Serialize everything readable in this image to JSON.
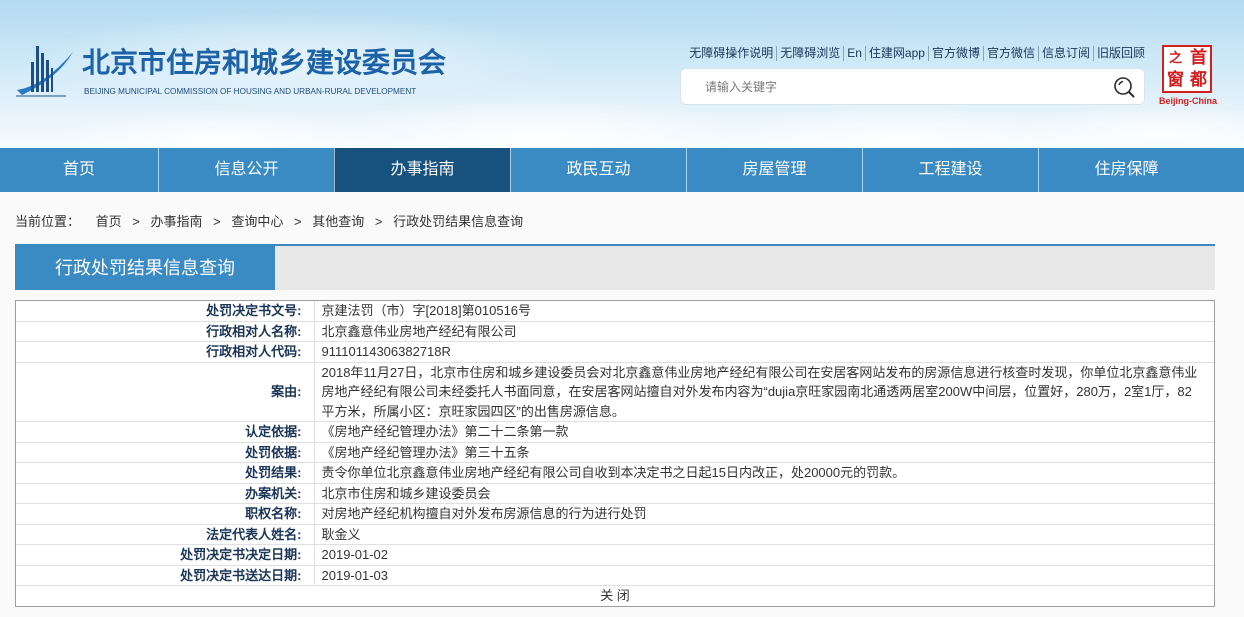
{
  "colors": {
    "primary": "#3a8ac3",
    "nav_active": "#17517e",
    "title_blue": "#1d62a7",
    "label_navy": "#1b3556",
    "portal_red": "#d0201f"
  },
  "header": {
    "title": "北京市住房和城乡建设委员会",
    "subtitle": "BEIJING MUNICIPAL COMMISSION OF HOUSING AND URBAN-RURAL DEVELOPMENT",
    "logo_icon": "commission-logo-icon",
    "top_links": [
      "无障碍操作说明",
      "无障碍浏览",
      "En",
      "住建网app",
      "官方微博",
      "官方微信",
      "信息订阅",
      "旧版回顾"
    ],
    "search": {
      "placeholder": "请输入关键字",
      "icon": "search-icon"
    },
    "portal_logo": {
      "char_1": "之",
      "char_2": "首",
      "char_3": "窗",
      "char_4": "都",
      "caption": "Beijing-China"
    }
  },
  "nav": {
    "items": [
      {
        "label": "首页",
        "active": false
      },
      {
        "label": "信息公开",
        "active": false
      },
      {
        "label": "办事指南",
        "active": true
      },
      {
        "label": "政民互动",
        "active": false
      },
      {
        "label": "房屋管理",
        "active": false
      },
      {
        "label": "工程建设",
        "active": false
      },
      {
        "label": "住房保障",
        "active": false
      }
    ]
  },
  "breadcrumb": {
    "prefix": "当前位置：",
    "separator": ">",
    "items": [
      "首页",
      "办事指南",
      "查询中心",
      "其他查询",
      "行政处罚结果信息查询"
    ]
  },
  "section": {
    "title": "行政处罚结果信息查询"
  },
  "record": {
    "rows": [
      {
        "label": "处罚决定书文号:",
        "value": "京建法罚（市）字[2018]第010516号"
      },
      {
        "label": "行政相对人名称:",
        "value": "北京鑫意伟业房地产经纪有限公司"
      },
      {
        "label": "行政相对人代码:",
        "value": "91110114306382718R"
      },
      {
        "label": "案由:",
        "value": "2018年11月27日，北京市住房和城乡建设委员会对北京鑫意伟业房地产经纪有限公司在安居客网站发布的房源信息进行核查时发现，你单位北京鑫意伟业房地产经纪有限公司未经委托人书面同意，在安居客网站擅自对外发布内容为“dujia京旺家园南北通透两居室200W中间层，位置好，280万，2室1厅，82平方米，所属小区：京旺家园四区”的出售房源信息。"
      },
      {
        "label": "认定依据:",
        "value": "《房地产经纪管理办法》第二十二条第一款"
      },
      {
        "label": "处罚依据:",
        "value": "《房地产经纪管理办法》第三十五条"
      },
      {
        "label": "处罚结果:",
        "value": "责令你单位北京鑫意伟业房地产经纪有限公司自收到本决定书之日起15日内改正，处20000元的罚款。"
      },
      {
        "label": "办案机关:",
        "value": "北京市住房和城乡建设委员会"
      },
      {
        "label": "职权名称:",
        "value": "对房地产经纪机构擅自对外发布房源信息的行为进行处罚"
      },
      {
        "label": "法定代表人姓名:",
        "value": "耿金义"
      },
      {
        "label": "处罚决定书决定日期:",
        "value": "2019-01-02"
      },
      {
        "label": "处罚决定书送达日期:",
        "value": "2019-01-03"
      }
    ],
    "close_label": "关 闭"
  }
}
